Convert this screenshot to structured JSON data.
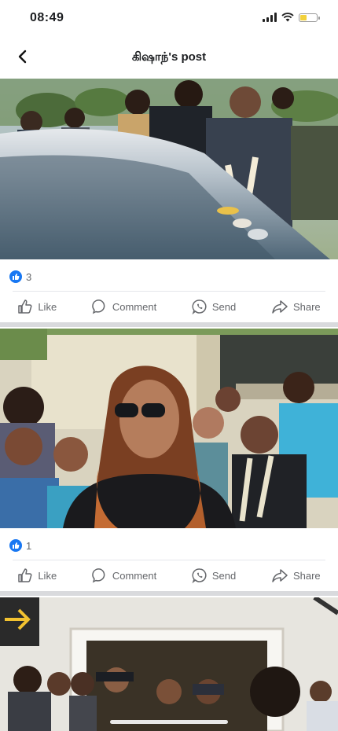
{
  "status_bar": {
    "time": "08:49"
  },
  "header": {
    "title": "கிஷாந்'s post"
  },
  "posts": [
    {
      "reaction_count": "3"
    },
    {
      "reaction_count": "1"
    }
  ],
  "actions": {
    "like": "Like",
    "comment": "Comment",
    "send": "Send",
    "share": "Share"
  },
  "colors": {
    "accent": "#1877f2",
    "battery": "#f2d13c",
    "divider": "#e4e6eb"
  }
}
